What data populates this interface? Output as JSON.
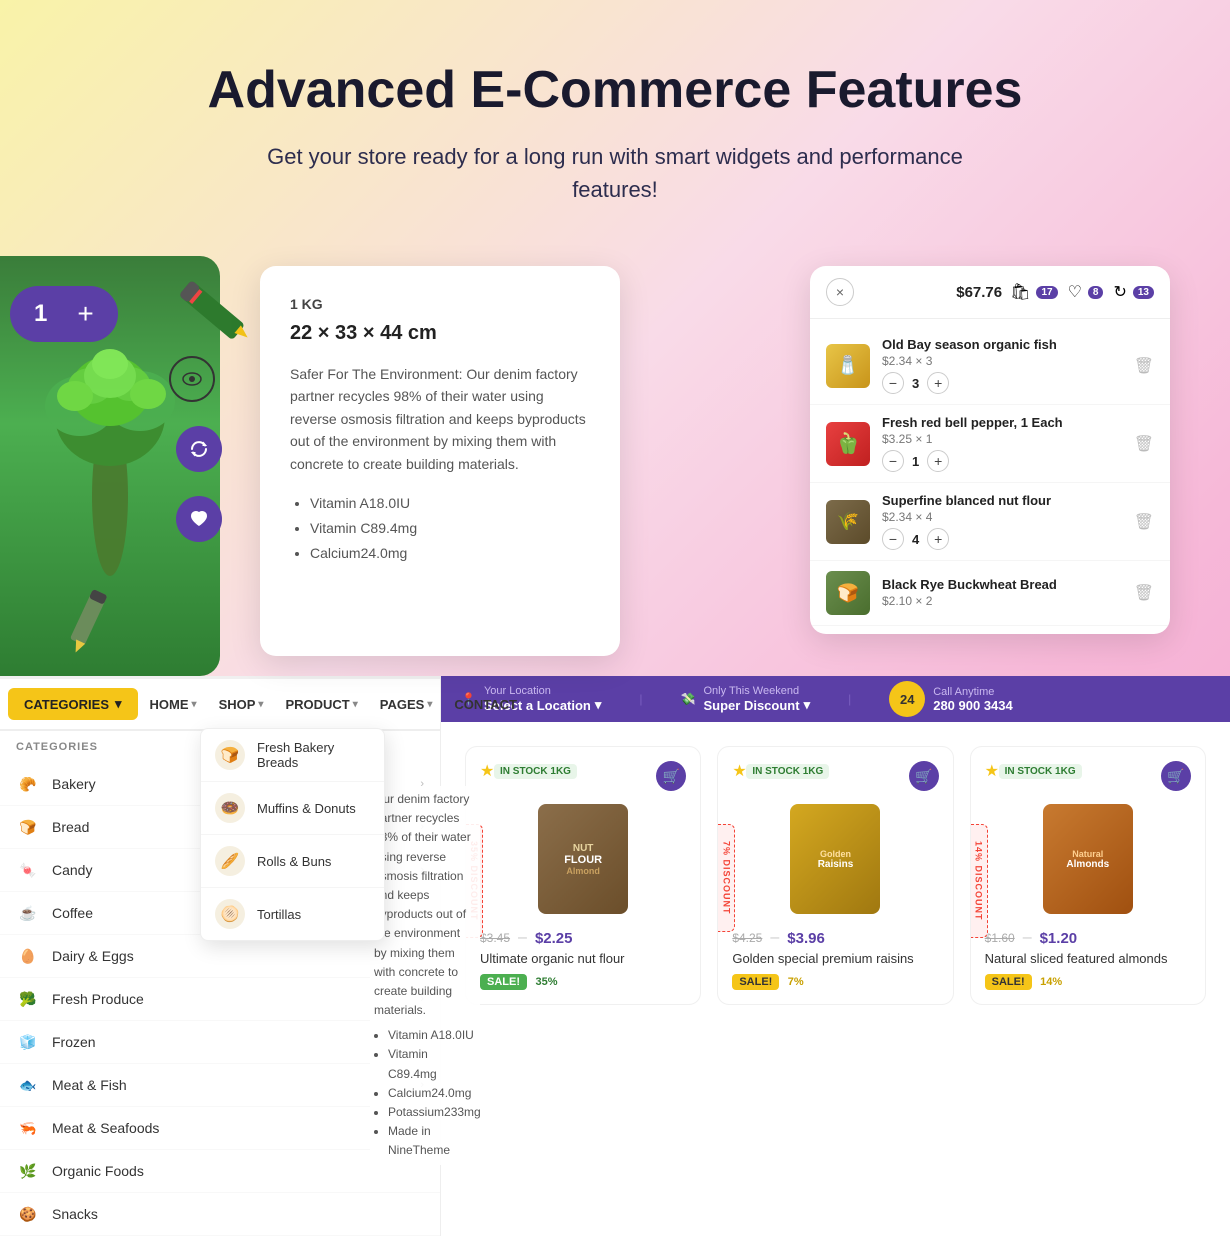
{
  "hero": {
    "title": "Advanced E-Commerce Features",
    "subtitle": "Get your store ready for a long run with smart widgets and performance features!"
  },
  "counter": {
    "value": "1",
    "plus": "+"
  },
  "product_card": {
    "weight": "1 KG",
    "dimensions": "22 × 33 × 44 cm",
    "description": "Safer For The Environment: Our denim factory partner recycles 98% of their water using reverse osmosis filtration and keeps byproducts out of the environment by mixing them with concrete to create building materials.",
    "bullets": [
      "Vitamin A18.0IU",
      "Vitamin C89.4mg",
      "Calcium24.0mg"
    ]
  },
  "cart": {
    "close_label": "×",
    "price": "$67.76",
    "cart_count": "17",
    "wishlist_count": "8",
    "compare_count": "13",
    "items": [
      {
        "name": "Old Bay season organic fish",
        "price": "$2.34 × 3",
        "qty": "3",
        "color": "old-bay"
      },
      {
        "name": "Fresh red bell pepper, 1 Each",
        "price": "$3.25 × 1",
        "qty": "1",
        "color": "pepper"
      },
      {
        "name": "Superfine blanced nut flour",
        "price": "$2.34 × 4",
        "qty": "4",
        "color": "flour"
      },
      {
        "name": "Black Rye Buckwheat Bread",
        "price": "$2.10 × 2",
        "qty": "2",
        "color": "bread"
      }
    ]
  },
  "nav": {
    "categories_label": "CATEGORIES",
    "items": [
      {
        "label": "HOME",
        "has_dropdown": true
      },
      {
        "label": "SHOP",
        "has_dropdown": true
      },
      {
        "label": "PRODUCT",
        "has_dropdown": true
      },
      {
        "label": "PAGES",
        "has_dropdown": true
      },
      {
        "label": "CONTACT",
        "has_dropdown": false
      }
    ]
  },
  "categories": {
    "header": "CATEGORIES",
    "items": [
      {
        "label": "Bakery",
        "icon": "🥐",
        "has_sub": true
      },
      {
        "label": "Bread",
        "icon": "🍞",
        "has_sub": true
      },
      {
        "label": "Candy",
        "icon": "🍬",
        "has_sub": true
      },
      {
        "label": "Coffee",
        "icon": "☕",
        "has_sub": true
      },
      {
        "label": "Dairy & Eggs",
        "icon": "🥚",
        "has_sub": true
      },
      {
        "label": "Fresh Produce",
        "icon": "🥦",
        "has_sub": true
      },
      {
        "label": "Frozen",
        "icon": "🧊",
        "has_sub": false
      },
      {
        "label": "Meat & Fish",
        "icon": "🐟",
        "has_sub": true
      },
      {
        "label": "Meat & Seafoods",
        "icon": "🦐",
        "has_sub": true
      },
      {
        "label": "Organic Foods",
        "icon": "🌿",
        "has_sub": false
      },
      {
        "label": "Snacks",
        "icon": "🍪",
        "has_sub": false
      }
    ]
  },
  "submenu": {
    "items": [
      {
        "label": "Fresh Bakery Breads",
        "icon": "🍞"
      },
      {
        "label": "Muffins & Donuts",
        "icon": "🍩"
      },
      {
        "label": "Rolls & Buns",
        "icon": "🥖"
      },
      {
        "label": "Tortillas",
        "icon": "🫓"
      }
    ]
  },
  "store_bar": {
    "location_label": "Your Location",
    "location_value": "Select a Location",
    "discount_label": "Only This Weekend",
    "discount_value": "Super Discount",
    "phone_label": "Call Anytime",
    "phone_number": "280 900 3434",
    "phone_icon_num": "24"
  },
  "products": [
    {
      "stock": "IN STOCK 1KG",
      "old_price": "$3.45",
      "new_price": "$2.25",
      "name": "Ultimate organic nut flour",
      "sale_label": "SALE!",
      "sale_pct": "35%",
      "sale_color": "green",
      "discount_ribbon": "35% DISCOUNT",
      "img_bg": "#7c6b4a",
      "img_label": "NUT FLOUR"
    },
    {
      "stock": "IN STOCK 1KG",
      "old_price": "$4.25",
      "new_price": "$3.96",
      "name": "Golden special premium raisins",
      "sale_label": "SALE!",
      "sale_pct": "7%",
      "sale_color": "yellow",
      "discount_ribbon": "7% DISCOUNT",
      "img_bg": "#c8941a",
      "img_label": "Golden Raisins"
    },
    {
      "stock": "IN STOCK 1KG",
      "old_price": "$1.60",
      "new_price": "$1.20",
      "name": "Natural sliced featured almonds",
      "sale_label": "SALE!",
      "sale_pct": "14%",
      "sale_color": "yellow",
      "discount_ribbon": "14% DISCOUNT",
      "img_bg": "#b87333",
      "img_label": "Almonds"
    }
  ]
}
